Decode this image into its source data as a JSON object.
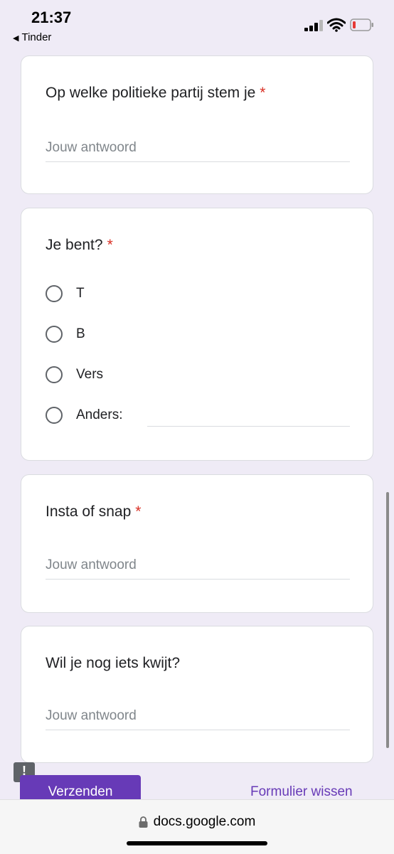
{
  "status": {
    "time": "21:37",
    "back_app": "Tinder"
  },
  "questions": [
    {
      "title": "Op welke politieke partij stem je",
      "required": "*",
      "placeholder": "Jouw antwoord"
    },
    {
      "title": "Je bent?",
      "required": "*",
      "options": [
        "T",
        "B",
        "Vers",
        "Anders:"
      ]
    },
    {
      "title": "Insta of snap",
      "required": "*",
      "placeholder": "Jouw antwoord"
    },
    {
      "title": "Wil je nog iets kwijt?",
      "placeholder": "Jouw antwoord"
    }
  ],
  "actions": {
    "submit": "Verzenden",
    "clear": "Formulier wissen"
  },
  "browser": {
    "url": "docs.google.com"
  },
  "colors": {
    "accent": "#673ab7",
    "required": "#d93025",
    "background": "#efebf6"
  }
}
